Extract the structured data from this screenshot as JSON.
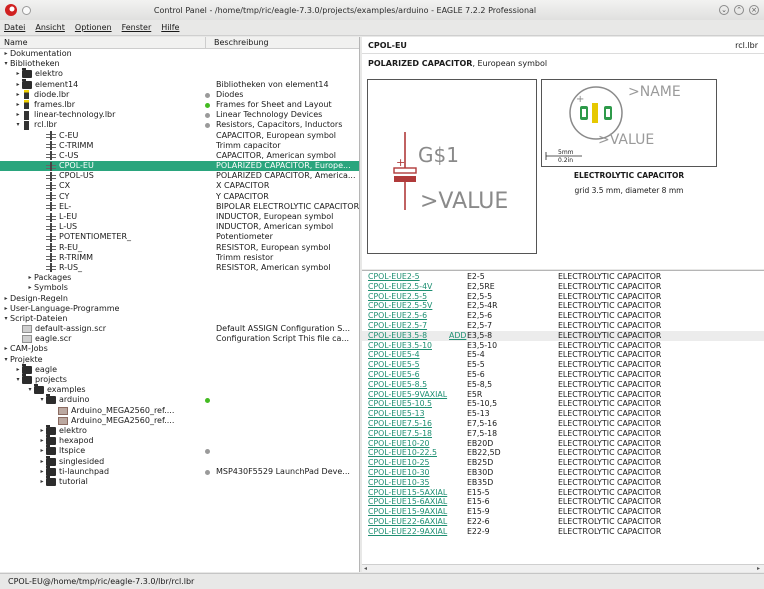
{
  "window": {
    "title": "Control Panel - /home/tmp/ric/eagle-7.3.0/projects/examples/arduino - EAGLE 7.2.2 Professional"
  },
  "menu": [
    "Datei",
    "Ansicht",
    "Optionen",
    "Fenster",
    "Hilfe"
  ],
  "tree": {
    "headers": [
      "Name",
      "Beschreibung"
    ],
    "rows": [
      {
        "indent": 0,
        "arrow": "▸",
        "icon": "",
        "name": "Dokumentation",
        "desc": "",
        "dot": ""
      },
      {
        "indent": 0,
        "arrow": "▾",
        "icon": "",
        "name": "Bibliotheken",
        "desc": "",
        "dot": ""
      },
      {
        "indent": 1,
        "arrow": "▸",
        "icon": "folder",
        "name": "elektro",
        "desc": "",
        "dot": ""
      },
      {
        "indent": 1,
        "arrow": "▸",
        "icon": "folder",
        "name": "element14",
        "desc": "Bibliotheken von element14",
        "dot": ""
      },
      {
        "indent": 1,
        "arrow": "▸",
        "icon": "lbr yel",
        "name": "diode.lbr",
        "desc": "Diodes",
        "dot": "#9a9a9a"
      },
      {
        "indent": 1,
        "arrow": "▸",
        "icon": "lbr yel",
        "name": "frames.lbr",
        "desc": "Frames for Sheet and Layout",
        "dot": "#44bb22"
      },
      {
        "indent": 1,
        "arrow": "▸",
        "icon": "lbr",
        "name": "linear-technology.lbr",
        "desc": "Linear Technology Devices",
        "dot": "#9a9a9a"
      },
      {
        "indent": 1,
        "arrow": "▾",
        "icon": "lbr",
        "name": "rcl.lbr",
        "desc": "Resistors, Capacitors, Inductors",
        "dot": "#9a9a9a"
      },
      {
        "indent": 3,
        "arrow": "",
        "icon": "dev",
        "name": "C-EU",
        "desc": "CAPACITOR, European symbol",
        "dot": ""
      },
      {
        "indent": 3,
        "arrow": "",
        "icon": "dev",
        "name": "C-TRIMM",
        "desc": "Trimm capacitor",
        "dot": ""
      },
      {
        "indent": 3,
        "arrow": "",
        "icon": "dev",
        "name": "C-US",
        "desc": "CAPACITOR, American symbol",
        "dot": ""
      },
      {
        "indent": 3,
        "arrow": "",
        "icon": "dev",
        "name": "CPOL-EU",
        "desc": "POLARIZED CAPACITOR, Europe...",
        "dot": "",
        "selected": true
      },
      {
        "indent": 3,
        "arrow": "",
        "icon": "dev",
        "name": "CPOL-US",
        "desc": "POLARIZED CAPACITOR, America...",
        "dot": ""
      },
      {
        "indent": 3,
        "arrow": "",
        "icon": "dev",
        "name": "CX",
        "desc": "X CAPACITOR",
        "dot": ""
      },
      {
        "indent": 3,
        "arrow": "",
        "icon": "dev",
        "name": "CY",
        "desc": "Y CAPACITOR",
        "dot": ""
      },
      {
        "indent": 3,
        "arrow": "",
        "icon": "dev",
        "name": "EL-",
        "desc": "BIPOLAR ELECTROLYTIC CAPACITOR",
        "dot": ""
      },
      {
        "indent": 3,
        "arrow": "",
        "icon": "dev",
        "name": "L-EU",
        "desc": "INDUCTOR, European symbol",
        "dot": ""
      },
      {
        "indent": 3,
        "arrow": "",
        "icon": "dev",
        "name": "L-US",
        "desc": "INDUCTOR, American symbol",
        "dot": ""
      },
      {
        "indent": 3,
        "arrow": "",
        "icon": "dev",
        "name": "POTENTIOMETER_",
        "desc": "Potentiometer",
        "dot": ""
      },
      {
        "indent": 3,
        "arrow": "",
        "icon": "dev",
        "name": "R-EU_",
        "desc": "RESISTOR, European symbol",
        "dot": ""
      },
      {
        "indent": 3,
        "arrow": "",
        "icon": "dev",
        "name": "R-TRIMM",
        "desc": "Trimm resistor",
        "dot": ""
      },
      {
        "indent": 3,
        "arrow": "",
        "icon": "dev",
        "name": "R-US_",
        "desc": "RESISTOR, American symbol",
        "dot": ""
      },
      {
        "indent": 2,
        "arrow": "▸",
        "icon": "",
        "name": "Packages",
        "desc": "",
        "dot": ""
      },
      {
        "indent": 2,
        "arrow": "▸",
        "icon": "",
        "name": "Symbols",
        "desc": "",
        "dot": ""
      },
      {
        "indent": 0,
        "arrow": "▸",
        "icon": "",
        "name": "Design-Regeln",
        "desc": "",
        "dot": ""
      },
      {
        "indent": 0,
        "arrow": "▸",
        "icon": "",
        "name": "User-Language-Programme",
        "desc": "",
        "dot": ""
      },
      {
        "indent": 0,
        "arrow": "▾",
        "icon": "",
        "name": "Script-Dateien",
        "desc": "",
        "dot": ""
      },
      {
        "indent": 1,
        "arrow": "",
        "icon": "scr",
        "name": "default-assign.scr",
        "desc": "Default ASSIGN Configuration S...",
        "dot": ""
      },
      {
        "indent": 1,
        "arrow": "",
        "icon": "scr",
        "name": "eagle.scr",
        "desc": "Configuration Script This file ca...",
        "dot": ""
      },
      {
        "indent": 0,
        "arrow": "▸",
        "icon": "",
        "name": "CAM-Jobs",
        "desc": "",
        "dot": ""
      },
      {
        "indent": 0,
        "arrow": "▾",
        "icon": "",
        "name": "Projekte",
        "desc": "",
        "dot": ""
      },
      {
        "indent": 1,
        "arrow": "▸",
        "icon": "folder",
        "name": "eagle",
        "desc": "",
        "dot": ""
      },
      {
        "indent": 1,
        "arrow": "▾",
        "icon": "folder",
        "name": "projects",
        "desc": "",
        "dot": ""
      },
      {
        "indent": 2,
        "arrow": "▾",
        "icon": "folder",
        "name": "examples",
        "desc": "",
        "dot": ""
      },
      {
        "indent": 3,
        "arrow": "▾",
        "icon": "folder",
        "name": "arduino",
        "desc": "",
        "dot": "#44bb22"
      },
      {
        "indent": 4,
        "arrow": "",
        "icon": "brd",
        "name": "Arduino_MEGA2560_ref....",
        "desc": "",
        "dot": ""
      },
      {
        "indent": 4,
        "arrow": "",
        "icon": "brd",
        "name": "Arduino_MEGA2560_ref....",
        "desc": "",
        "dot": ""
      },
      {
        "indent": 3,
        "arrow": "▸",
        "icon": "folder",
        "name": "elektro",
        "desc": "",
        "dot": ""
      },
      {
        "indent": 3,
        "arrow": "▸",
        "icon": "folder",
        "name": "hexapod",
        "desc": "",
        "dot": ""
      },
      {
        "indent": 3,
        "arrow": "▸",
        "icon": "folder",
        "name": "ltspice",
        "desc": "",
        "dot": "#9a9a9a"
      },
      {
        "indent": 3,
        "arrow": "▸",
        "icon": "folder",
        "name": "singlesided",
        "desc": "",
        "dot": ""
      },
      {
        "indent": 3,
        "arrow": "▸",
        "icon": "folder",
        "name": "ti-launchpad",
        "desc": "MSP430F5529 LaunchPad Deve...",
        "dot": "#9a9a9a"
      },
      {
        "indent": 3,
        "arrow": "▸",
        "icon": "folder",
        "name": "tutorial",
        "desc": "",
        "dot": ""
      }
    ]
  },
  "device": {
    "name": "CPOL-EU",
    "library": "rcl.lbr",
    "title_bold": "POLARIZED CAPACITOR",
    "title_rest": ", European symbol",
    "symbol_name": "G$1",
    "symbol_value": ">VALUE",
    "package_name_text": ">NAME",
    "package_value_text": ">VALUE",
    "scale_top": "5mm",
    "scale_bottom": "0.2in",
    "package_label": "ELECTROLYTIC CAPACITOR",
    "package_sub": "grid 3.5 mm, diameter 8 mm"
  },
  "packages": [
    {
      "name": "CPOL-EUE2-5",
      "pkg": "E2-5",
      "desc": "ELECTROLYTIC CAPACITOR"
    },
    {
      "name": "CPOL-EUE2.5-4V",
      "pkg": "E2,5RE",
      "desc": "ELECTROLYTIC CAPACITOR"
    },
    {
      "name": "CPOL-EUE2.5-5",
      "pkg": "E2,5-5",
      "desc": "ELECTROLYTIC CAPACITOR"
    },
    {
      "name": "CPOL-EUE2.5-5V",
      "pkg": "E2,5-4R",
      "desc": "ELECTROLYTIC CAPACITOR"
    },
    {
      "name": "CPOL-EUE2.5-6",
      "pkg": "E2,5-6",
      "desc": "ELECTROLYTIC CAPACITOR"
    },
    {
      "name": "CPOL-EUE2.5-7",
      "pkg": "E2,5-7",
      "desc": "ELECTROLYTIC CAPACITOR"
    },
    {
      "name": "CPOL-EUE3.5-8",
      "pkg": "E3,5-8",
      "desc": "ELECTROLYTIC CAPACITOR",
      "add": "ADD",
      "highlight": true
    },
    {
      "name": "CPOL-EUE3.5-10",
      "pkg": "E3,5-10",
      "desc": "ELECTROLYTIC CAPACITOR"
    },
    {
      "name": "CPOL-EUE5-4",
      "pkg": "E5-4",
      "desc": "ELECTROLYTIC CAPACITOR"
    },
    {
      "name": "CPOL-EUE5-5",
      "pkg": "E5-5",
      "desc": "ELECTROLYTIC CAPACITOR"
    },
    {
      "name": "CPOL-EUE5-6",
      "pkg": "E5-6",
      "desc": "ELECTROLYTIC CAPACITOR"
    },
    {
      "name": "CPOL-EUE5-8.5",
      "pkg": "E5-8,5",
      "desc": "ELECTROLYTIC CAPACITOR"
    },
    {
      "name": "CPOL-EUE5-9VAXIAL",
      "pkg": "E5R",
      "desc": "ELECTROLYTIC CAPACITOR"
    },
    {
      "name": "CPOL-EUE5-10.5",
      "pkg": "E5-10,5",
      "desc": "ELECTROLYTIC CAPACITOR"
    },
    {
      "name": "CPOL-EUE5-13",
      "pkg": "E5-13",
      "desc": "ELECTROLYTIC CAPACITOR"
    },
    {
      "name": "CPOL-EUE7.5-16",
      "pkg": "E7,5-16",
      "desc": "ELECTROLYTIC CAPACITOR"
    },
    {
      "name": "CPOL-EUE7.5-18",
      "pkg": "E7,5-18",
      "desc": "ELECTROLYTIC CAPACITOR"
    },
    {
      "name": "CPOL-EUE10-20",
      "pkg": "EB20D",
      "desc": "ELECTROLYTIC CAPACITOR"
    },
    {
      "name": "CPOL-EUE10-22.5",
      "pkg": "EB22,5D",
      "desc": "ELECTROLYTIC CAPACITOR"
    },
    {
      "name": "CPOL-EUE10-25",
      "pkg": "EB25D",
      "desc": "ELECTROLYTIC CAPACITOR"
    },
    {
      "name": "CPOL-EUE10-30",
      "pkg": "EB30D",
      "desc": "ELECTROLYTIC CAPACITOR"
    },
    {
      "name": "CPOL-EUE10-35",
      "pkg": "EB35D",
      "desc": "ELECTROLYTIC CAPACITOR"
    },
    {
      "name": "CPOL-EUE15-5AXIAL",
      "pkg": "E15-5",
      "desc": "ELECTROLYTIC CAPACITOR"
    },
    {
      "name": "CPOL-EUE15-6AXIAL",
      "pkg": "E15-6",
      "desc": "ELECTROLYTIC CAPACITOR"
    },
    {
      "name": "CPOL-EUE15-9AXIAL",
      "pkg": "E15-9",
      "desc": "ELECTROLYTIC CAPACITOR"
    },
    {
      "name": "CPOL-EUE22-6AXIAL",
      "pkg": "E22-6",
      "desc": "ELECTROLYTIC CAPACITOR"
    },
    {
      "name": "CPOL-EUE22-9AXIAL",
      "pkg": "E22-9",
      "desc": "ELECTROLYTIC CAPACITOR"
    }
  ],
  "status": "CPOL-EU@/home/tmp/ric/eagle-7.3.0/lbr/rcl.lbr",
  "colors": {
    "selection": "#2aa57d",
    "link": "#1e8f72",
    "symbol_red": "#b03a3a",
    "pad_green": "#2e9a4a",
    "pad_yellow": "#e6c800"
  },
  "icons": {
    "app": "eagle-app-icon",
    "window_buttons": [
      "minimize-icon",
      "maximize-icon",
      "close-icon"
    ]
  }
}
